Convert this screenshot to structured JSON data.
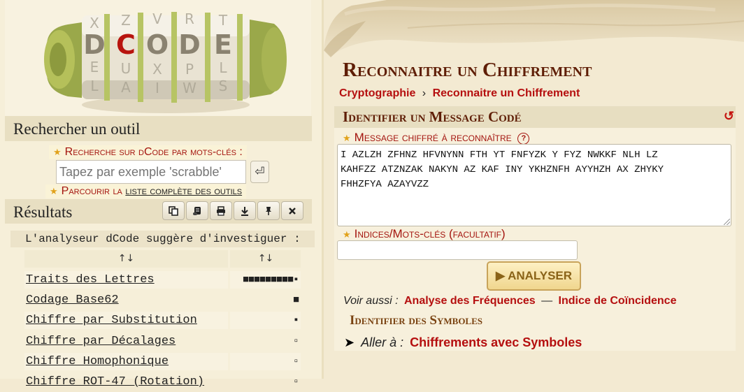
{
  "logo": {
    "letters": [
      "D",
      "C",
      "O",
      "D",
      "E"
    ],
    "alt": "dCode"
  },
  "search": {
    "heading": "Rechercher un outil",
    "keywords_label": "Recherche sur dCode par mots-clés :",
    "placeholder": "Tapez par exemple 'scrabble'",
    "go_symbol": "⏎",
    "browse_prefix": "Parcourir la ",
    "browse_link": "liste complète des outils"
  },
  "results": {
    "heading": "Résultats",
    "toolbar_icons": [
      "copy-icon",
      "scroll-icon",
      "print-icon",
      "download-icon",
      "pin-icon",
      "close-icon"
    ],
    "suggestion": "L'analyseur dCode suggère d'investiguer :",
    "col_sort": "↑↓",
    "rows": [
      {
        "name": "Traits des Lettres",
        "score": "■■■■■■■■■▪"
      },
      {
        "name": "Codage Base62",
        "score": "■"
      },
      {
        "name": "Chiffre par Substitution",
        "score": "▪"
      },
      {
        "name": "Chiffre par Décalages",
        "score": "▫"
      },
      {
        "name": "Chiffre Homophonique",
        "score": "▫"
      },
      {
        "name": "Chiffre ROT-47 (Rotation)",
        "score": "▫"
      }
    ]
  },
  "main": {
    "title": "Reconnaitre un Chiffrement",
    "breadcrumb": [
      "Cryptographie",
      "Reconnaitre un Chiffrement"
    ],
    "breadcrumb_sep": "›",
    "panel_title": "Identifier un Message Codé",
    "reset_symbol": "↺",
    "cipher_label": "Message chiffré à reconnaître",
    "help_symbol": "?",
    "cipher_text": "I AZLZH ZFHNZ HFVNYNN FTH YT FNFYZK Y FYZ NWKKF NLH LZ\nKAHFZZ ATZNZAK NAKYN AZ KAF INY YKHZNFH AYYHZH AX ZHYKY\nFHHZFYA AZAYVZZ",
    "keywords_label": "Indices/Mots-clés (facultatif)",
    "keywords_value": "",
    "analyze_label": "▶ ANALYSER",
    "see_also_label": "Voir aussi :",
    "see_also_links": [
      "Analyse des Fréquences",
      "Indice de Coïncidence"
    ],
    "see_also_sep": "—",
    "symbols_title": "Identifier des Symboles",
    "goto_arrow": "➤",
    "goto_label": "Aller à :",
    "goto_link": "Chiffrements avec Symboles"
  },
  "colors": {
    "accent": "#b50f0f",
    "title": "#5f1e06",
    "parchment": "#f3ead2",
    "star": "#e1a21b"
  }
}
